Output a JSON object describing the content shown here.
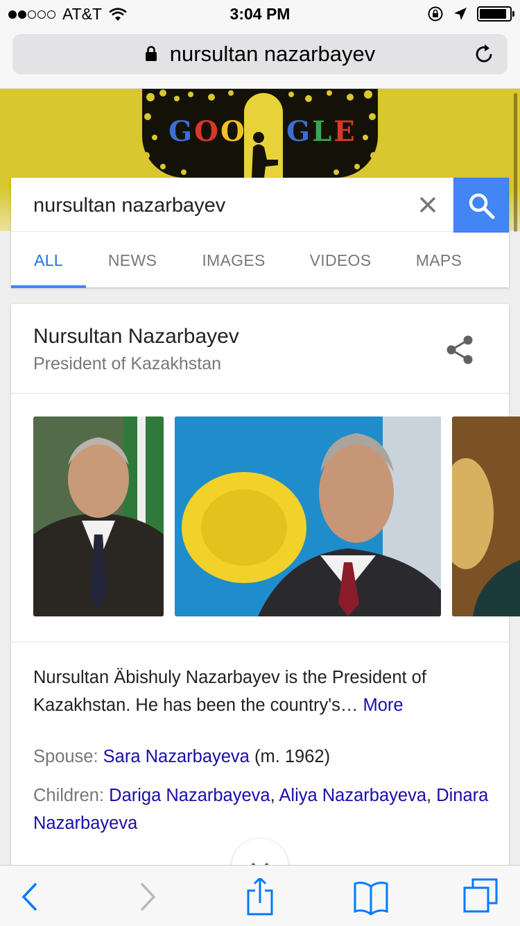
{
  "status_bar": {
    "carrier": "AT&T",
    "time": "3:04 PM",
    "signal_bars_filled": 2,
    "signal_bars_total": 5,
    "battery_level": 0.9
  },
  "browser": {
    "url_text": "nursultan nazarbayev",
    "icons": [
      "lock-icon",
      "reload-icon"
    ]
  },
  "doodle": {
    "left_letters": "GOO",
    "right_letters": "GLE",
    "colors": {
      "G": "#3b6fd1",
      "O1": "#d9372b",
      "O2": "#f2c029",
      "G2": "#3b6fd1",
      "L": "#36a852",
      "E": "#d9372b"
    },
    "background_color": "#d9c72f"
  },
  "search": {
    "query": "nursultan nazarbayev",
    "button_color": "#4285f4",
    "tabs": [
      {
        "label": "ALL",
        "active": true
      },
      {
        "label": "NEWS",
        "active": false
      },
      {
        "label": "IMAGES",
        "active": false
      },
      {
        "label": "VIDEOS",
        "active": false
      },
      {
        "label": "MAPS",
        "active": false
      }
    ]
  },
  "knowledge_panel": {
    "title": "Nursultan Nazarbayev",
    "subtitle": "President of Kazakhstan",
    "description": "Nursultan Äbishuly Nazarbayev is the President of Kazakhstan. He has been the country's…",
    "more_link": "More",
    "spouse": {
      "label": "Spouse:",
      "name": "Sara Nazarbayeva",
      "detail": "(m. 1962)"
    },
    "children": {
      "label": "Children:",
      "names": [
        "Dariga Nazarbayeva",
        "Aliya Nazarbayeva",
        "Dinara Nazarbayeva"
      ],
      "separator": ","
    },
    "photos": [
      "portrait-photo",
      "flag-background-photo",
      "cropped-photo"
    ]
  },
  "toolbar": {
    "icons": [
      "back-chevron-icon",
      "forward-chevron-icon",
      "share-icon",
      "bookmarks-icon",
      "tabs-icon"
    ],
    "accent_color": "#007aff"
  }
}
